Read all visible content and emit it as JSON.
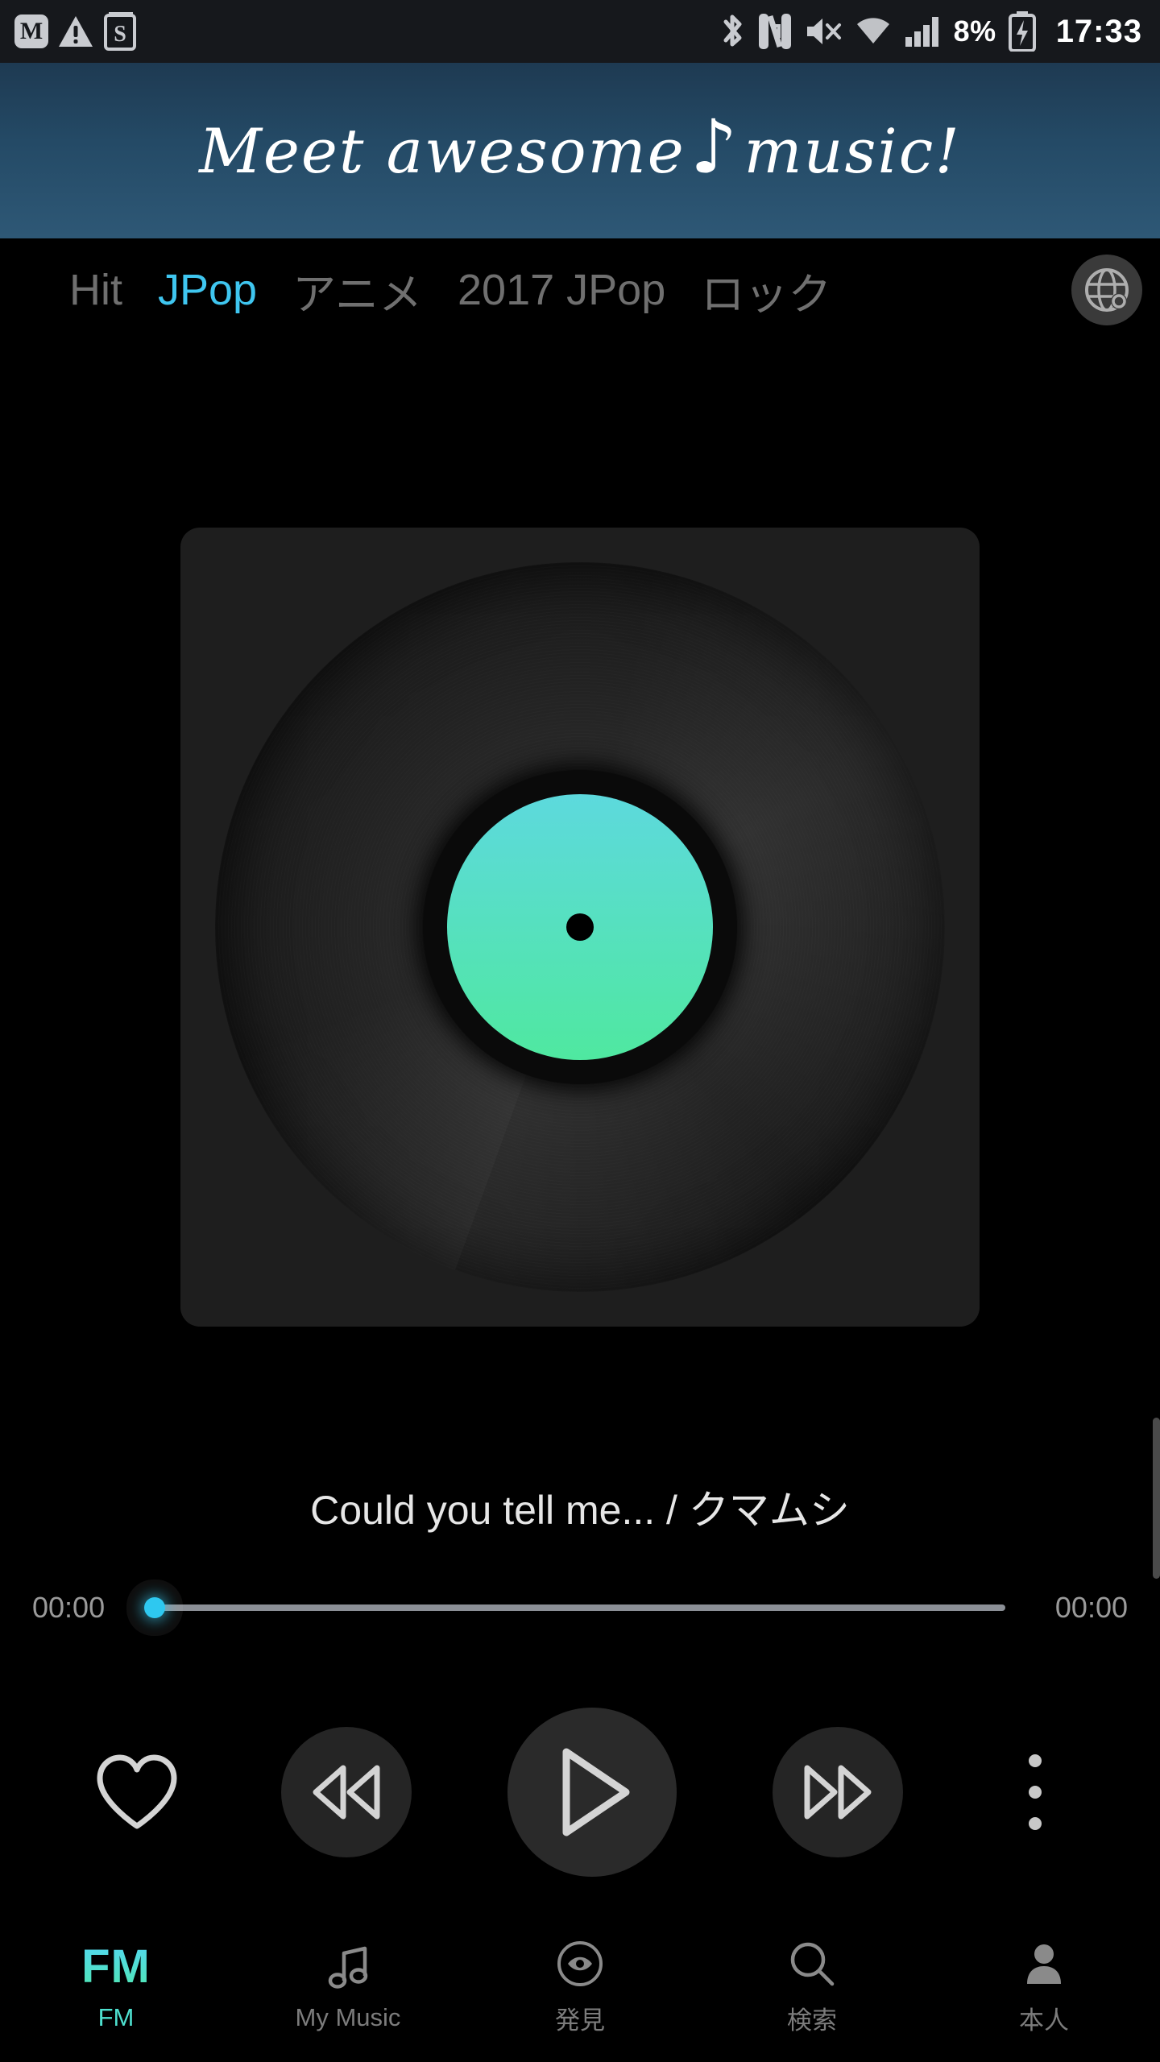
{
  "statusbar": {
    "time": "17:33",
    "battery_percent": "8%",
    "icons": [
      {
        "name": "m-app-icon",
        "glyph": "M"
      },
      {
        "name": "warning-triangle-icon",
        "glyph": "!"
      },
      {
        "name": "s-app-icon",
        "glyph": "S"
      },
      {
        "name": "bluetooth-icon",
        "glyph": "bluetooth"
      },
      {
        "name": "nfc-icon",
        "glyph": "N"
      },
      {
        "name": "mute-icon",
        "glyph": "speaker-muted"
      },
      {
        "name": "wifi-icon",
        "glyph": "wifi"
      },
      {
        "name": "cellular-signal-icon",
        "glyph": "signal-bars"
      },
      {
        "name": "battery-charging-icon",
        "glyph": "battery"
      }
    ]
  },
  "banner": {
    "text_before": "Meet awesome",
    "note_glyph": "♪",
    "text_after": "music!",
    "gradient_top": "#1e3a52",
    "gradient_bottom": "#2e5876"
  },
  "tabs": {
    "items": [
      {
        "label": "Hit",
        "active": false
      },
      {
        "label": "JPop",
        "active": true
      },
      {
        "label": "アニメ",
        "active": false
      },
      {
        "label": "2017 JPop",
        "active": false
      },
      {
        "label": "ロック",
        "active": false
      }
    ],
    "globe_icon": "globe-radio-icon",
    "active_color": "#3fc6f0",
    "inactive_color": "#6f6f6f"
  },
  "player": {
    "album_art": {
      "icon": "vinyl-record",
      "label_gradient_top": "#5dd9dd",
      "label_gradient_bottom": "#4fe8a0"
    },
    "track_title": "Could you tell me... / クマムシ",
    "elapsed_time": "00:00",
    "total_time": "00:00",
    "progress_percent": 0,
    "thumb_color": "#2ec8f0",
    "controls": [
      {
        "name": "favorite-button",
        "icon": "heart-icon"
      },
      {
        "name": "rewind-button",
        "icon": "rewind-icon"
      },
      {
        "name": "play-button",
        "icon": "play-icon"
      },
      {
        "name": "fast-forward-button",
        "icon": "fast-forward-icon"
      },
      {
        "name": "more-options-button",
        "icon": "more-vertical-icon"
      }
    ]
  },
  "bottomnav": {
    "items": [
      {
        "label": "FM",
        "icon": "fm-text-icon",
        "active": true
      },
      {
        "label": "My Music",
        "icon": "music-note-icon",
        "active": false
      },
      {
        "label": "発見",
        "icon": "compass-icon",
        "active": false
      },
      {
        "label": "検索",
        "icon": "search-icon",
        "active": false
      },
      {
        "label": "本人",
        "icon": "person-icon",
        "active": false
      }
    ],
    "active_color": "#4ee0cf",
    "inactive_color": "#7c7c7c"
  }
}
